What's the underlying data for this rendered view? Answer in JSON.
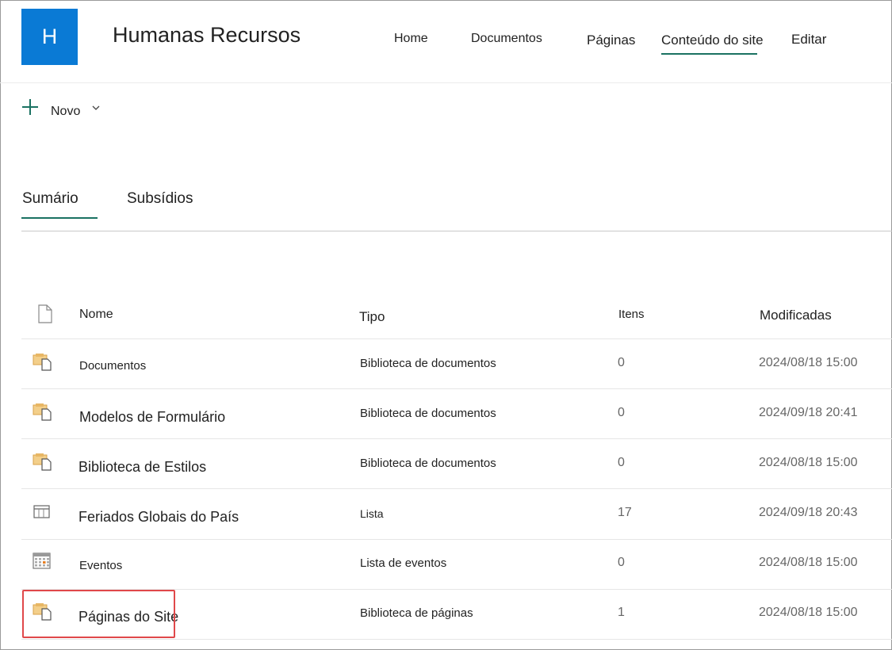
{
  "site": {
    "logo_letter": "H",
    "title": "Humanas Recursos"
  },
  "nav": {
    "items": [
      "Home",
      "Documentos",
      "Páginas",
      "Conteúdo do site",
      "Editar"
    ]
  },
  "command_bar": {
    "new_label": "Novo"
  },
  "tabs": [
    "Sumário",
    "Subsídios"
  ],
  "table": {
    "headers": {
      "name": "Nome",
      "type": "Tipo",
      "items": "Itens",
      "modified": "Modificadas"
    },
    "rows": [
      {
        "icon": "document-library-icon",
        "name": "Documentos",
        "type": "Biblioteca de documentos",
        "items": "0",
        "modified": "2024/08/18 15:00"
      },
      {
        "icon": "document-library-icon",
        "name": "Modelos de Formulário",
        "type": "Biblioteca de documentos",
        "items": "0",
        "modified": "2024/09/18 20:41"
      },
      {
        "icon": "document-library-icon",
        "name": "Biblioteca de Estilos",
        "type": "Biblioteca de documentos",
        "items": "0",
        "modified": "2024/08/18 15:00"
      },
      {
        "icon": "list-icon",
        "name": "Feriados Globais do País",
        "type": "Lista",
        "items": "17",
        "modified": "2024/09/18 20:43"
      },
      {
        "icon": "calendar-icon",
        "name": "Eventos",
        "type": "Lista de eventos",
        "items": "0",
        "modified": "2024/08/18 15:00"
      },
      {
        "icon": "document-library-icon",
        "name": "Páginas do Site",
        "type": "Biblioteca de páginas",
        "items": "1",
        "modified": "2024/08/18 15:00"
      }
    ]
  },
  "colors": {
    "brand": "#0a7ad5",
    "accent": "#1b7262",
    "highlight": "#e0484a",
    "folder": "#e8b765"
  }
}
